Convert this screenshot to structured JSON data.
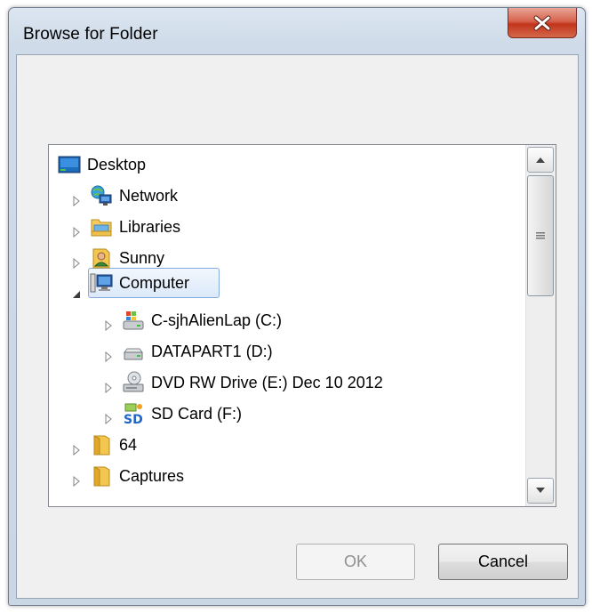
{
  "window": {
    "title": "Browse for Folder"
  },
  "tree": {
    "items": [
      {
        "label": "Desktop",
        "icon": "desktop-icon",
        "expander": "none"
      },
      {
        "label": "Network",
        "icon": "network-icon",
        "expander": "collapsed"
      },
      {
        "label": "Libraries",
        "icon": "libraries-icon",
        "expander": "collapsed"
      },
      {
        "label": "Sunny",
        "icon": "user-folder-icon",
        "expander": "collapsed"
      },
      {
        "label": "Computer",
        "icon": "computer-icon",
        "expander": "expanded",
        "selected": true
      },
      {
        "label": "C-sjhAlienLap (C:)",
        "icon": "system-drive-icon",
        "expander": "collapsed"
      },
      {
        "label": "DATAPART1 (D:)",
        "icon": "hard-drive-icon",
        "expander": "collapsed"
      },
      {
        "label": "DVD RW Drive (E:) Dec 10 2012",
        "icon": "dvd-drive-icon",
        "expander": "collapsed"
      },
      {
        "label": "SD Card (F:)",
        "icon": "sd-card-icon",
        "expander": "collapsed"
      },
      {
        "label": "64",
        "icon": "folder-icon",
        "expander": "collapsed"
      },
      {
        "label": "Captures",
        "icon": "folder-icon",
        "expander": "collapsed"
      }
    ]
  },
  "buttons": {
    "ok_label": "OK",
    "cancel_label": "Cancel",
    "ok_enabled": false
  },
  "colors": {
    "selection_border": "#84acdd",
    "selection_fill": "#dbe9fa",
    "close_button": "#c2351c"
  }
}
